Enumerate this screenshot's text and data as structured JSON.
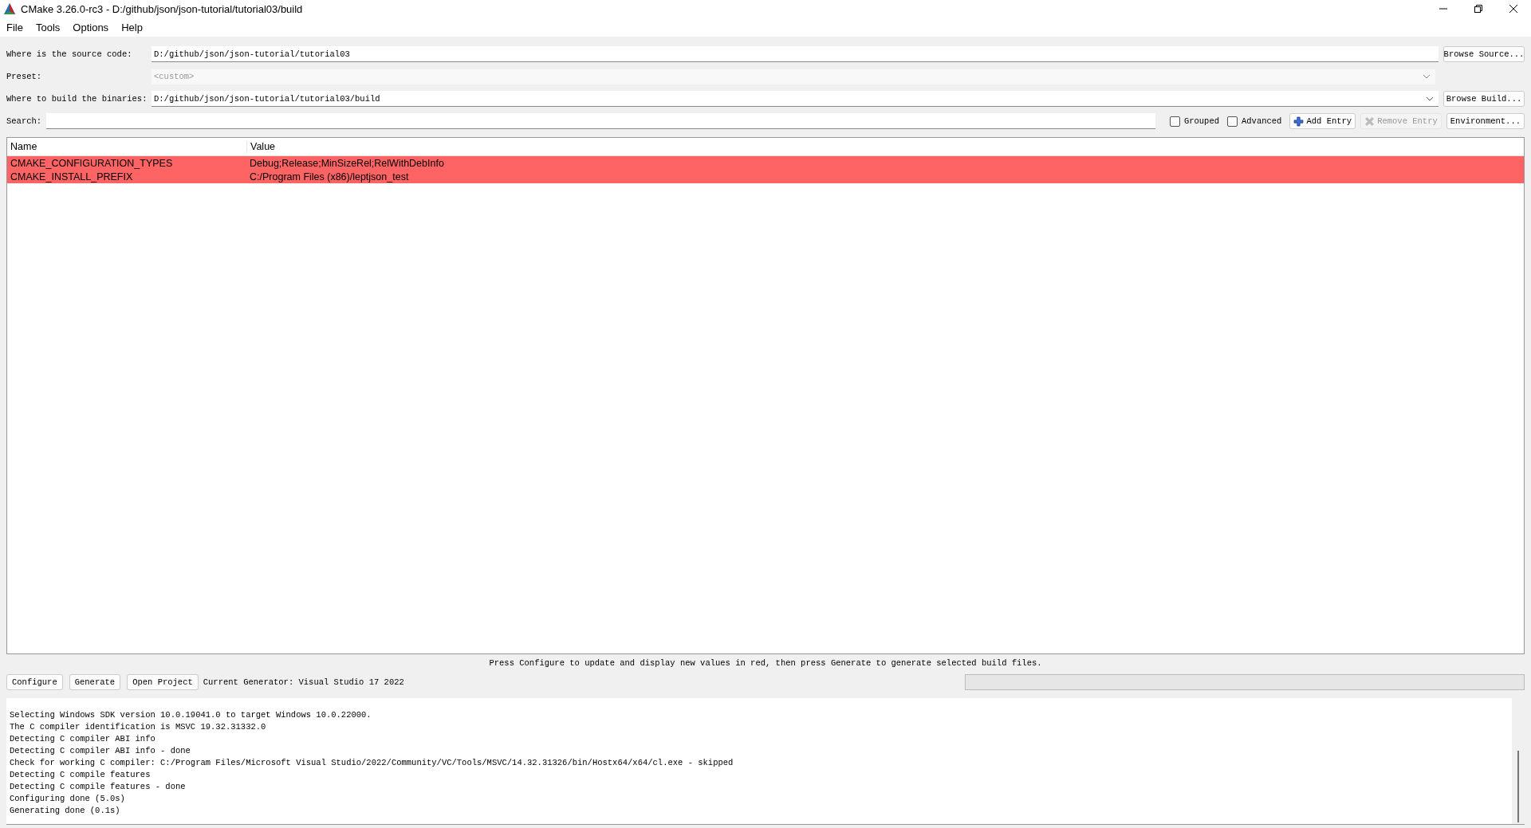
{
  "window": {
    "title": "CMake 3.26.0-rc3 - D:/github/json/json-tutorial/tutorial03/build"
  },
  "menu": [
    "File",
    "Tools",
    "Options",
    "Help"
  ],
  "source": {
    "label": "Where is the source code:",
    "value": "D:/github/json/json-tutorial/tutorial03",
    "button": "Browse Source..."
  },
  "preset": {
    "label": "Preset:",
    "value": "<custom>",
    "disabled": true
  },
  "build": {
    "label": "Where to build the binaries:",
    "value": "D:/github/json/json-tutorial/tutorial03/build",
    "button": "Browse Build..."
  },
  "search": {
    "label": "Search:"
  },
  "options": [
    {
      "label": "Grouped",
      "checked": false
    },
    {
      "label": "Advanced",
      "checked": false
    }
  ],
  "actions": [
    {
      "label": "Add Entry",
      "kind": "add",
      "disabled": false
    },
    {
      "label": "Remove Entry",
      "kind": "remove",
      "disabled": true
    },
    {
      "label": "Environment...",
      "kind": "plain",
      "disabled": false
    }
  ],
  "table": {
    "columns": [
      "Name",
      "Value"
    ],
    "rows": [
      {
        "name": "CMAKE_CONFIGURATION_TYPES",
        "value": "Debug;Release;MinSizeRel;RelWithDebInfo",
        "new": true
      },
      {
        "name": "CMAKE_INSTALL_PREFIX",
        "value": "C:/Program Files (x86)/leptjson_test",
        "new": true
      }
    ]
  },
  "hint": "Press Configure to update and display new values in red, then press Generate to generate selected build files.",
  "buttons": [
    "Configure",
    "Generate",
    "Open Project"
  ],
  "generator": "Current Generator: Visual Studio 17 2022",
  "progress": {
    "level": 0
  },
  "output": [
    "Selecting Windows SDK version 10.0.19041.0 to target Windows 10.0.22000.",
    "The C compiler identification is MSVC 19.32.31332.0",
    "Detecting C compiler ABI info",
    "Detecting C compiler ABI info - done",
    "Check for working C compiler: C:/Program Files/Microsoft Visual Studio/2022/Community/VC/Tools/MSVC/14.32.31326/bin/Hostx64/x64/cl.exe - skipped",
    "Detecting C compile features",
    "Detecting C compile features - done",
    "Configuring done (5.0s)",
    "Generating done (0.1s)"
  ]
}
